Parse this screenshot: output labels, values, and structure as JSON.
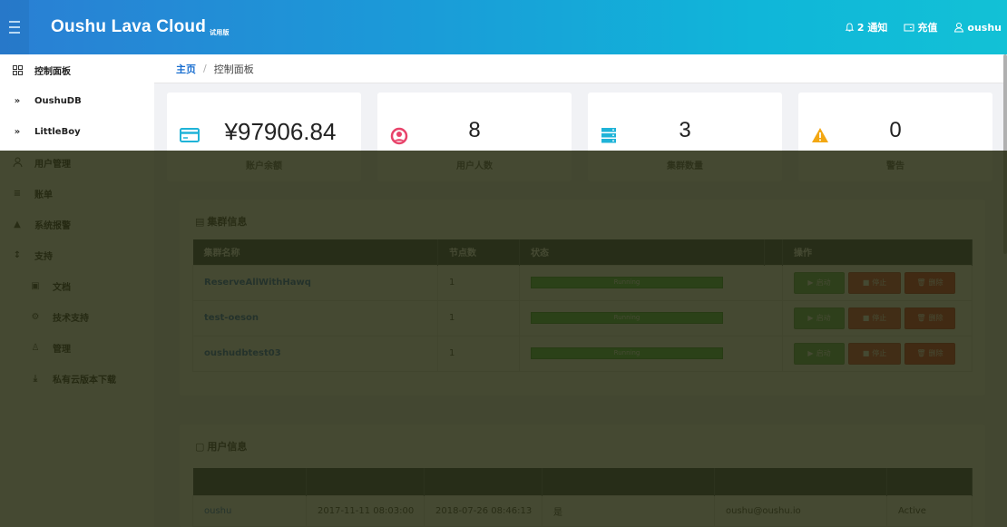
{
  "header": {
    "brand": "Oushu Lava Cloud",
    "brand_tag": "试用版",
    "notifications": "2 通知",
    "recharge": "充值",
    "user": "oushu"
  },
  "sidebar": {
    "items": [
      {
        "icon": "grid-icon",
        "label": "控制面板"
      },
      {
        "icon": "chevron-double-right-icon",
        "label": "OushuDB"
      },
      {
        "icon": "chevron-double-right-icon",
        "label": "LittleBoy"
      },
      {
        "icon": "user-icon",
        "label": "用户管理"
      },
      {
        "icon": "list-icon",
        "label": "账单"
      },
      {
        "icon": "warning-icon",
        "label": "系统报警"
      },
      {
        "icon": "pin-icon",
        "label": "支持"
      }
    ],
    "sub_items": [
      {
        "icon": "doc-icon",
        "label": "文档"
      },
      {
        "icon": "gear-icon",
        "label": "技术支持"
      },
      {
        "icon": "person-icon",
        "label": "管理"
      },
      {
        "icon": "download-icon",
        "label": "私有云版本下载"
      }
    ]
  },
  "breadcrumb": {
    "home": "主页",
    "separator": "/",
    "current": "控制面板"
  },
  "stats": [
    {
      "icon": "card-icon",
      "value": "¥97906.84",
      "label": "账户余额",
      "color": "#1fb3d8"
    },
    {
      "icon": "user-circle-icon",
      "value": "8",
      "label": "用户人数",
      "color": "#e8436a"
    },
    {
      "icon": "server-icon",
      "value": "3",
      "label": "集群数量",
      "color": "#1fb3d8"
    },
    {
      "icon": "warning-icon",
      "value": "0",
      "label": "警告",
      "color": "#f3a712"
    }
  ],
  "cluster_panel": {
    "title": "集群信息",
    "columns": [
      "集群名称",
      "节点数",
      "状态",
      "",
      "操作"
    ],
    "rows": [
      {
        "name": "ReserveAllWithHawq",
        "nodes": "1",
        "status": "Running"
      },
      {
        "name": "test-oeson",
        "nodes": "1",
        "status": "Running"
      },
      {
        "name": "oushudbtest03",
        "nodes": "1",
        "status": "Running"
      }
    ],
    "actions": {
      "start": "启动",
      "stop": "停止",
      "delete": "删除"
    }
  },
  "user_panel": {
    "title": "用户信息",
    "rows": [
      {
        "name": "oushu",
        "created": "2017-11-11 08:03:00",
        "updated": "2018-07-26 08:46:13",
        "flag": "是",
        "email": "oushu@oushu.io",
        "status": "Active"
      }
    ]
  }
}
